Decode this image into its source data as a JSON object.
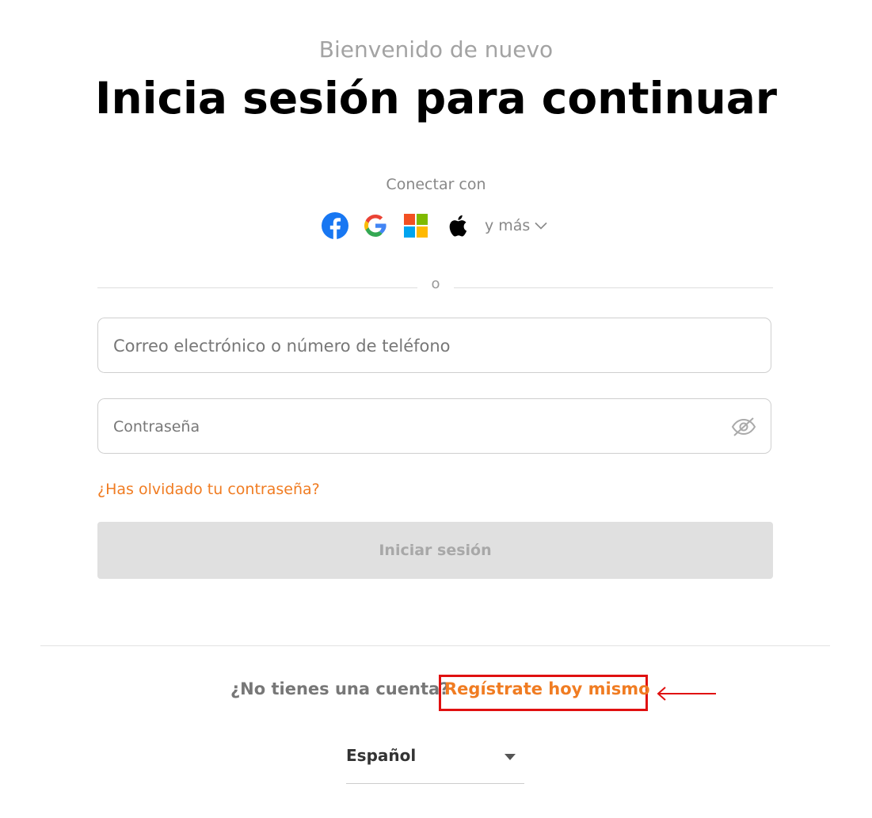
{
  "header": {
    "welcome": "Bienvenido de nuevo",
    "title": "Inicia sesión para continuar"
  },
  "social": {
    "label": "Conectar con",
    "providers": [
      {
        "name": "facebook-icon",
        "color": "#1877F2"
      },
      {
        "name": "google-icon",
        "colors": [
          "#4285F4",
          "#EA4335",
          "#FBBC05",
          "#34A853"
        ]
      },
      {
        "name": "microsoft-icon",
        "colors": [
          "#F25022",
          "#7FBA00",
          "#00A4EF",
          "#FFB900"
        ]
      },
      {
        "name": "apple-icon",
        "color": "#000000"
      }
    ],
    "more_label": "y más",
    "more_icon": "chevron-down-icon"
  },
  "divider": {
    "or_label": "o"
  },
  "form": {
    "email_placeholder": "Correo electrónico o número de teléfono",
    "password_placeholder": "Contraseña",
    "password_toggle_icon": "eye-slash-icon",
    "forgot_label": "¿Has olvidado tu contraseña?",
    "submit_label": "Iniciar sesión"
  },
  "footer": {
    "no_account_label": "¿No tienes una cuenta?",
    "register_label": "Regístrate hoy mismo",
    "language_label": "Español",
    "language_icon": "caret-down-icon"
  },
  "colors": {
    "accent": "#f07c22",
    "highlight_box": "#e01010",
    "disabled_button_bg": "#e0e0e0",
    "disabled_button_text": "#a8a8a8"
  }
}
